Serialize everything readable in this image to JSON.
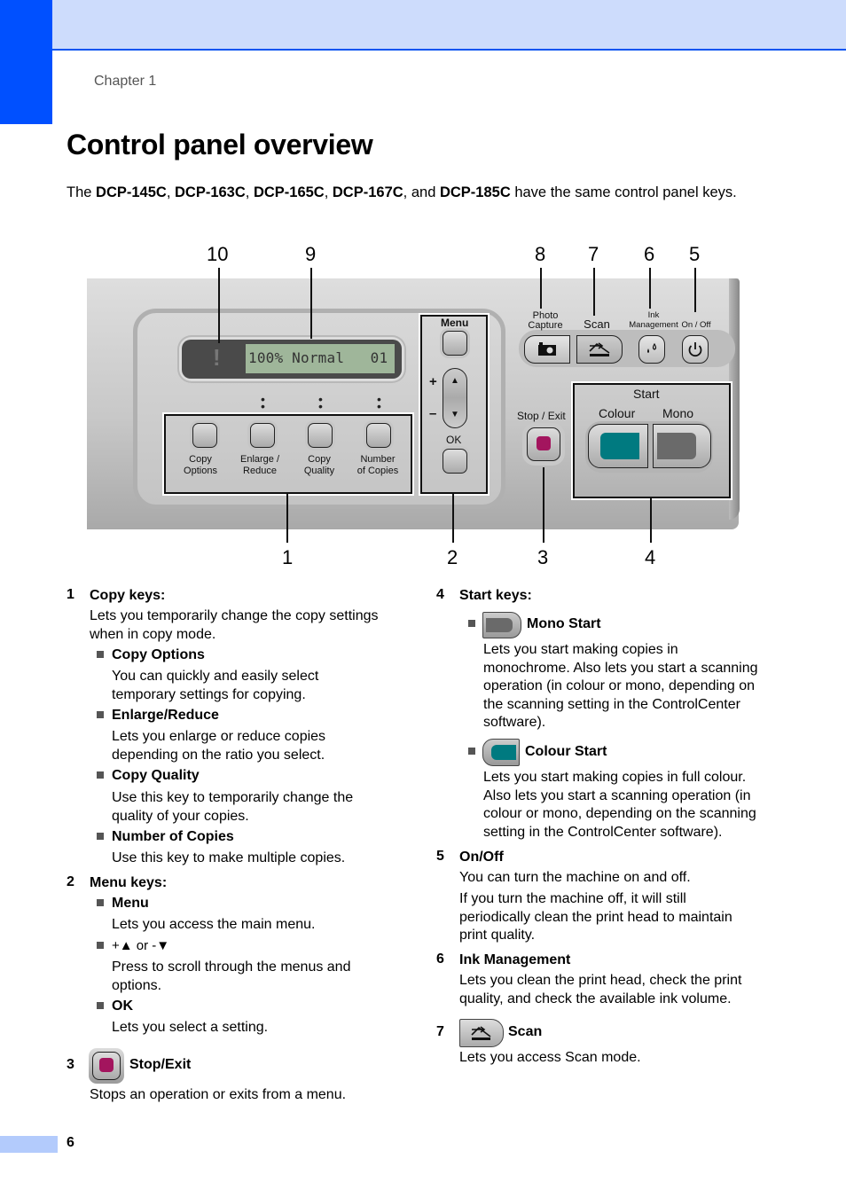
{
  "header": {
    "chapter": "Chapter 1",
    "accent_color": "#0050ff",
    "band_color": "#cddcfc"
  },
  "page": {
    "title": "Control panel overview",
    "intro_pre": "The ",
    "models": [
      "DCP-145C",
      "DCP-163C",
      "DCP-165C",
      "DCP-167C",
      "DCP-185C"
    ],
    "intro_sep1": ", ",
    "intro_and": ", and ",
    "intro_post": " have the same control panel keys.",
    "page_number": "6"
  },
  "figure": {
    "callouts_top": [
      "10",
      "9",
      "8",
      "7",
      "6",
      "5"
    ],
    "callouts_bottom": [
      "1",
      "2",
      "3",
      "4"
    ],
    "lcd": {
      "warning": "!",
      "text": "100% Normal   01"
    },
    "copy_keys": [
      {
        "line1": "Copy",
        "line2": "Options"
      },
      {
        "line1": "Enlarge /",
        "line2": "Reduce"
      },
      {
        "line1": "Copy",
        "line2": "Quality"
      },
      {
        "line1": "Number",
        "line2": "of Copies"
      }
    ],
    "menu_label": "Menu",
    "plus": "+",
    "minus": "–",
    "up": "▲",
    "down": "▼",
    "ok_label": "OK",
    "mode_keys": [
      {
        "line1": "Photo",
        "line2": "Capture"
      },
      {
        "line1": "",
        "line2": "Scan"
      },
      {
        "line1": "Ink",
        "line2": "Management"
      },
      {
        "line1": "",
        "line2": "On / Off"
      }
    ],
    "stop_label": "Stop / Exit",
    "start_label": "Start",
    "colour_label": "Colour",
    "mono_label": "Mono",
    "colors": {
      "stop": "#a3155e",
      "colour_start": "#007a80",
      "mono_start": "#6a6a6a"
    }
  },
  "left_column": {
    "sections": [
      {
        "num": "1",
        "title": "Copy keys:",
        "desc": "Lets you temporarily change the copy settings when in copy mode.",
        "items": [
          {
            "title": "Copy Options",
            "desc": "You can quickly and easily select temporary settings for copying."
          },
          {
            "title": "Enlarge/Reduce",
            "desc": "Lets you enlarge or reduce copies depending on the ratio you select."
          },
          {
            "title": "Copy Quality",
            "desc": "Use this key to temporarily change the quality of your copies."
          },
          {
            "title": "Number of Copies",
            "desc": "Use this key to make multiple copies."
          }
        ]
      },
      {
        "num": "2",
        "title": "Menu keys:",
        "items": [
          {
            "title": "Menu",
            "desc": "Lets you access the main menu."
          },
          {
            "title": "+▲ or -▼",
            "desc": "Press to scroll through the menus and options."
          },
          {
            "title": "OK",
            "desc": "Lets you select a setting."
          }
        ]
      },
      {
        "num": "3",
        "title": "Stop/Exit",
        "desc": "Stops an operation or exits from a menu."
      }
    ]
  },
  "right_column": {
    "sections": [
      {
        "num": "4",
        "title": "Start keys:",
        "items": [
          {
            "title": "Mono Start",
            "desc": "Lets you start making copies in monochrome. Also lets you start a scanning operation (in colour or mono, depending on the scanning setting in the ControlCenter software)."
          },
          {
            "title": "Colour Start",
            "desc": "Lets you start making copies in full colour. Also lets you start a scanning operation (in colour or mono, depending on the scanning setting in the ControlCenter software)."
          }
        ]
      },
      {
        "num": "5",
        "title": "On/Off",
        "desc": "You can turn the machine on and off.",
        "desc2": "If you turn the machine off, it will still periodically clean the print head to maintain print quality."
      },
      {
        "num": "6",
        "title": "Ink Management",
        "desc": "Lets you clean the print head, check the print quality, and check the available ink volume."
      },
      {
        "num": "7",
        "title": "Scan",
        "desc": "Lets you access Scan mode."
      }
    ]
  }
}
